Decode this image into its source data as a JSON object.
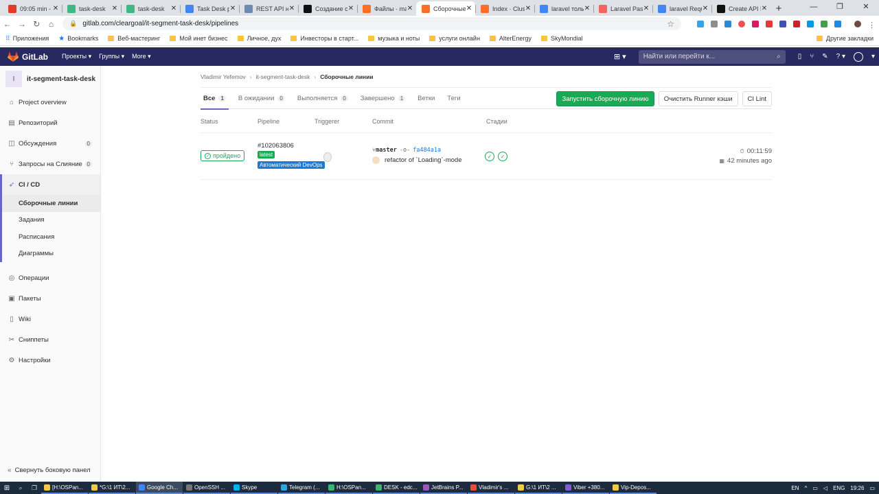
{
  "browser": {
    "tabs": [
      {
        "title": "09:05 min -",
        "color": "#e23b2e"
      },
      {
        "title": "task-desk",
        "color": "#41b883"
      },
      {
        "title": "task-desk",
        "color": "#41b883"
      },
      {
        "title": "Task Desk p",
        "color": "#4285f4"
      },
      {
        "title": "REST API на",
        "color": "#6d8bb1"
      },
      {
        "title": "Создание с",
        "color": "#111111"
      },
      {
        "title": "Файлы · ma",
        "color": "#fc6d26"
      },
      {
        "title": "Сборочные",
        "color": "#fc6d26",
        "active": true
      },
      {
        "title": "Index · Clust",
        "color": "#fc6d26"
      },
      {
        "title": "laravel толь",
        "color": "#4285f4"
      },
      {
        "title": "Laravel Pass",
        "color": "#f4645f"
      },
      {
        "title": "laravel Requ",
        "color": "#4285f4"
      },
      {
        "title": "Create API R",
        "color": "#111111"
      }
    ],
    "new_tab": "+",
    "url": "gitlab.com/cleargoal/it-segment-task-desk/pipelines",
    "bookmarks": [
      {
        "label": "Приложения",
        "kind": "apps"
      },
      {
        "label": "Bookmarks",
        "kind": "star"
      },
      {
        "label": "Веб-мастеринг",
        "kind": "folder"
      },
      {
        "label": "Мой инет бизнес",
        "kind": "folder"
      },
      {
        "label": "Личное, дух",
        "kind": "folder"
      },
      {
        "label": "Инвесторы в старт...",
        "kind": "folder"
      },
      {
        "label": "музыка и ноты",
        "kind": "folder"
      },
      {
        "label": "услуги онлайн",
        "kind": "folder"
      },
      {
        "label": "AlterEnergy",
        "kind": "folder"
      },
      {
        "label": "SkyMondial",
        "kind": "folder"
      }
    ],
    "other_bookmarks": "Другие закладки"
  },
  "gitlab": {
    "brand": "GitLab",
    "nav": [
      "Проекты ▾",
      "Группы ▾",
      "More ▾"
    ],
    "search_placeholder": "Найти или перейти к...",
    "colors": {
      "header": "#292961",
      "success": "#1aaa55",
      "info": "#1f78d1",
      "accent": "#6666c4"
    }
  },
  "sidebar": {
    "project_initial": "I",
    "project_name": "it-segment-task-desk",
    "items": [
      {
        "label": "Project overview",
        "icon": "home-icon"
      },
      {
        "label": "Репозиторий",
        "icon": "doc-icon"
      },
      {
        "label": "Обсуждения",
        "icon": "issues-icon",
        "count": "0"
      },
      {
        "label": "Запросы на Слияние",
        "icon": "merge-icon",
        "count": "0"
      },
      {
        "label": "CI / CD",
        "icon": "rocket-icon",
        "active": true
      }
    ],
    "cicd_subitems": [
      {
        "label": "Сборочные линии",
        "active": true
      },
      {
        "label": "Задания"
      },
      {
        "label": "Расписания"
      },
      {
        "label": "Диаграммы"
      }
    ],
    "items_bottom": [
      {
        "label": "Операции",
        "icon": "ops-icon"
      },
      {
        "label": "Пакеты",
        "icon": "package-icon"
      },
      {
        "label": "Wiki",
        "icon": "book-icon"
      },
      {
        "label": "Сниппеты",
        "icon": "scissors-icon"
      },
      {
        "label": "Настройки",
        "icon": "gear-icon"
      }
    ],
    "collapse": "Свернуть боковую панел"
  },
  "breadcrumb": [
    "Vladimir Yefemov",
    "it-segment-task-desk",
    "Сборочные линии"
  ],
  "pipeline_tabs": [
    {
      "label": "Все",
      "count": "1",
      "active": true
    },
    {
      "label": "В ожидании",
      "count": "0"
    },
    {
      "label": "Выполняется",
      "count": "0"
    },
    {
      "label": "Завершено",
      "count": "1"
    },
    {
      "label": "Ветки"
    },
    {
      "label": "Теги"
    }
  ],
  "buttons": {
    "run": "Запустить сборочную линию",
    "clear_cache": "Очистить Runner кэши",
    "ci_lint": "CI Lint"
  },
  "table": {
    "headers": {
      "status": "Status",
      "pipeline": "Pipeline",
      "triggerer": "Triggerer",
      "commit": "Commit",
      "stages": "Стадии"
    },
    "row": {
      "status": "пройдено",
      "pipeline_id": "#102063806",
      "badge_latest": "latest",
      "badge_devops": "Автоматический DevOps",
      "branch": "master",
      "sha": "fa484a1a",
      "message": "refactor of `Loading`-mode",
      "duration": "00:11:59",
      "finished": "42 minutes ago"
    }
  },
  "taskbar": {
    "items": [
      {
        "label": "[H:\\OSPan...",
        "color": "#f2c94c"
      },
      {
        "label": "*G:\\1 ИТ\\2...",
        "color": "#f2c94c"
      },
      {
        "label": "Google Ch...",
        "color": "#4285f4",
        "active": true
      },
      {
        "label": "OpenSSH ...",
        "color": "#777777"
      },
      {
        "label": "Skype",
        "color": "#00aff0"
      },
      {
        "label": "Telegram (...",
        "color": "#2ca5e0"
      },
      {
        "label": "H:\\OSPan...",
        "color": "#3cb371"
      },
      {
        "label": "DESK - edc...",
        "color": "#3cb371"
      },
      {
        "label": "JetBrains P...",
        "color": "#9b59b6"
      },
      {
        "label": "Vladimir's ...",
        "color": "#e74c3c"
      },
      {
        "label": "G:\\1 ИТ\\2 ...",
        "color": "#f2c94c"
      },
      {
        "label": "Viber +380...",
        "color": "#7f5fd0"
      },
      {
        "label": "Vip-Depos...",
        "color": "#f2c94c"
      }
    ],
    "lang": "EN",
    "lang2": "ENG",
    "time": "19:26"
  }
}
